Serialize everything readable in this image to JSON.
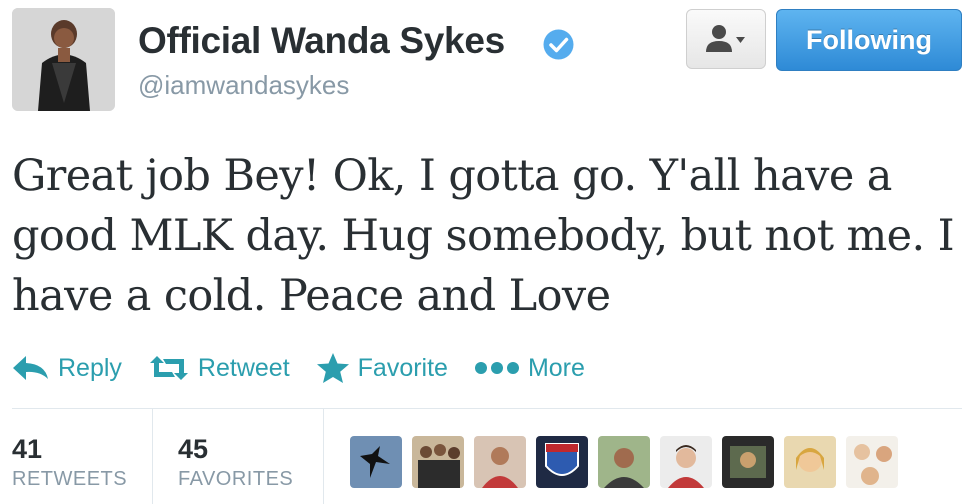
{
  "profile": {
    "name": "Official Wanda Sykes",
    "handle": "@iamwandasykes"
  },
  "buttons": {
    "following_label": "Following"
  },
  "tweet": {
    "text": "Great job Bey! Ok, I gotta go. Y'all have a good MLK day. Hug somebody, but not me. I have a cold. Peace and Love"
  },
  "actions": {
    "reply": "Reply",
    "retweet": "Retweet",
    "favorite": "Favorite",
    "more": "More"
  },
  "stats": {
    "retweets": {
      "count": "41",
      "label": "RETWEETS"
    },
    "favorites": {
      "count": "45",
      "label": "FAVORITES"
    }
  },
  "colors": {
    "action_teal": "#2b9eae",
    "follow_blue": "#2e8ad6",
    "verified_blue": "#55acee"
  }
}
